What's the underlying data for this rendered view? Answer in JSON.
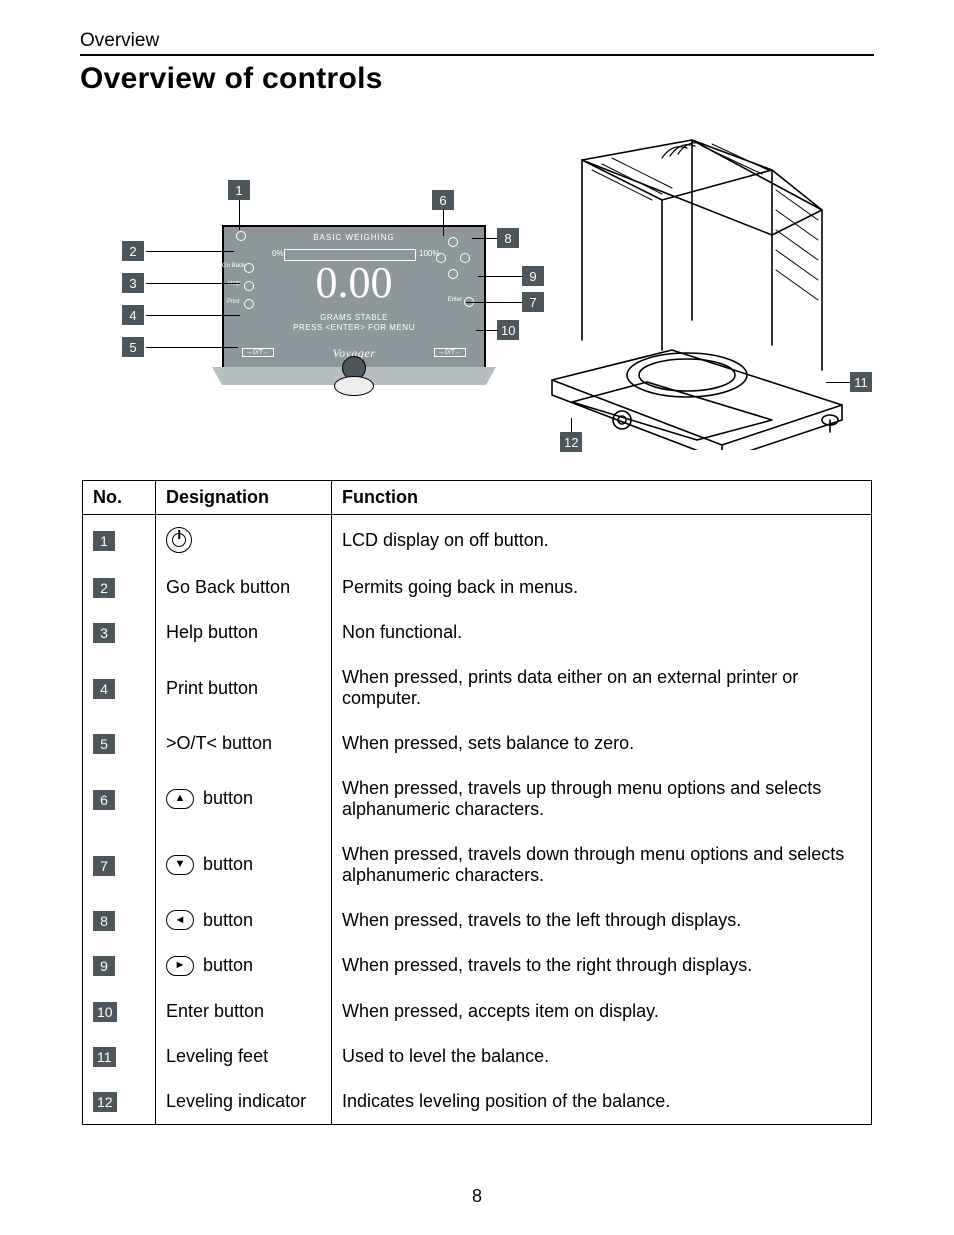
{
  "running_head": "Overview",
  "section_title": "Overview of controls",
  "page_number": "8",
  "lcd": {
    "title": "BASIC WEIGHING",
    "pct_left": "0%",
    "pct_right": "100%",
    "main": "0.00",
    "sub_line1": "GRAMS        STABLE",
    "sub_line2": "PRESS <ENTER> FOR MENU",
    "brand": "Voyager",
    "tare_left": "→0/T←",
    "tare_right": "→0/T←",
    "side_labels": {
      "go_back": "Go Back",
      "help": "Help",
      "print": "Print",
      "enter": "Enter"
    }
  },
  "callouts": {
    "c1": "1",
    "c2": "2",
    "c3": "3",
    "c4": "4",
    "c5": "5",
    "c6": "6",
    "c7": "7",
    "c8": "8",
    "c9": "9",
    "c10": "10",
    "c11": "11",
    "c12": "12"
  },
  "table": {
    "headers": {
      "no": "No.",
      "designation": "Designation",
      "function": "Function"
    },
    "rows": [
      {
        "no": "1",
        "designation_icon": "power",
        "designation_text": "",
        "function": "LCD display on off button."
      },
      {
        "no": "2",
        "designation_text": "Go Back button",
        "function": "Permits going back in menus."
      },
      {
        "no": "3",
        "designation_text": "Help button",
        "function": "Non functional."
      },
      {
        "no": "4",
        "designation_text": "Print button",
        "function": "When pressed, prints data either on an external printer or computer."
      },
      {
        "no": "5",
        "designation_text": ">O/T< button",
        "function": "When pressed, sets balance to zero."
      },
      {
        "no": "6",
        "designation_icon": "up",
        "designation_text": " button",
        "function": "When pressed, travels up through menu options and selects alphanumeric characters."
      },
      {
        "no": "7",
        "designation_icon": "down",
        "designation_text": " button",
        "function": "When pressed, travels down through menu options and selects alphanumeric characters."
      },
      {
        "no": "8",
        "designation_icon": "left",
        "designation_text": " button",
        "function": "When pressed, travels to the left through displays."
      },
      {
        "no": "9",
        "designation_icon": "right",
        "designation_text": " button",
        "function": "When pressed, travels to the right through displays."
      },
      {
        "no": "10",
        "designation_text": "Enter button",
        "function": "When pressed, accepts item on display."
      },
      {
        "no": "11",
        "designation_text": "Leveling feet",
        "function": "Used to level the balance."
      },
      {
        "no": "12",
        "designation_text": "Leveling indicator",
        "function": "Indicates leveling position of the balance."
      }
    ]
  }
}
